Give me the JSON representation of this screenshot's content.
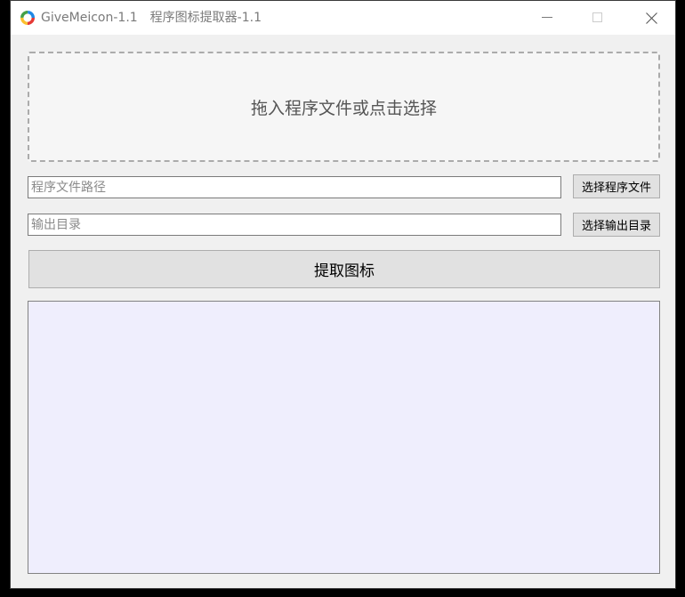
{
  "window": {
    "app_name": "GiveMeicon-1.1",
    "subtitle": "程序图标提取器-1.1",
    "icon": "app-ring-icon",
    "controls": {
      "minimize_icon": "minimize-icon",
      "maximize_icon": "maximize-icon",
      "close_icon": "close-icon"
    }
  },
  "dropzone": {
    "label": "拖入程序文件或点击选择"
  },
  "file_path": {
    "value": "",
    "placeholder": "程序文件路径",
    "button_label": "选择程序文件"
  },
  "output_dir": {
    "value": "",
    "placeholder": "输出目录",
    "button_label": "选择输出目录"
  },
  "extract_button": {
    "label": "提取图标"
  },
  "colors": {
    "window_bg": "#f0f0f0",
    "output_bg": "#efeefd",
    "button_bg": "#e1e1e1"
  }
}
